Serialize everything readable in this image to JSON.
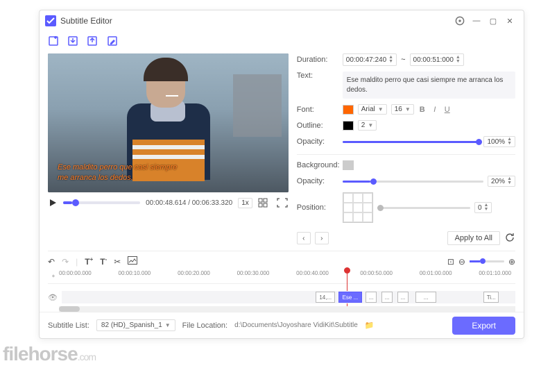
{
  "titlebar": {
    "title": "Subtitle Editor"
  },
  "subtitle_overlay": {
    "line1": "Ese maldito perro que casi siempre",
    "line2": "me arranca los dedos."
  },
  "player": {
    "time": "00:00:48.614 / 00:06:33.320",
    "rate": "1x"
  },
  "props": {
    "duration_label": "Duration:",
    "dur_start": "00:00:47:240",
    "dur_sep": "~",
    "dur_end": "00:00:51:000",
    "text_label": "Text:",
    "text_value": "Ese maldito perro que casi siempre me arranca los dedos.",
    "font_label": "Font:",
    "font_color": "#ff6600",
    "font_name": "Arial",
    "font_size": "16",
    "outline_label": "Outline:",
    "outline_color": "#000000",
    "outline_size": "2",
    "opacity_label": "Opacity:",
    "opacity_value": "100%",
    "background_label": "Background:",
    "bg_opacity_label": "Opacity:",
    "bg_opacity_value": "20%",
    "position_label": "Position:",
    "position_offset": "0",
    "apply_all": "Apply to All"
  },
  "ruler": {
    "ticks": [
      "00:00:00.000",
      "00:00:10.000",
      "00:00:20.000",
      "00:00:30.000",
      "00:00:40.000",
      "00:00:50.000",
      "00:01:00.000",
      "00:01:10.000"
    ]
  },
  "clips": {
    "c1": "14,...",
    "c2": "Ese ...",
    "c3": "...",
    "c4": "...",
    "c5": "...",
    "c6": "...",
    "c7": "Ti..."
  },
  "footer": {
    "list_label": "Subtitle List:",
    "list_value": "82 (HD)_Spanish_1",
    "loc_label": "File Location:",
    "loc_value": "d:\\Documents\\Joyoshare VidiKit\\Subtitle",
    "export": "Export"
  },
  "watermark": {
    "name": "filehorse",
    "suffix": ".com"
  }
}
